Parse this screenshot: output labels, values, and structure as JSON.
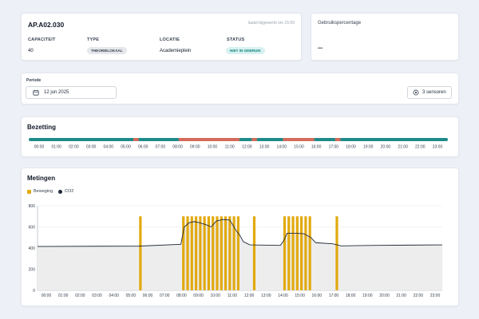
{
  "room": {
    "code": "AP.A02.030",
    "updated": "laatst bijgewerkt om 15:00",
    "fields": [
      {
        "label": "CAPACITEIT",
        "value": "40"
      },
      {
        "label": "TYPE",
        "value": "THEORIELOKAAL"
      },
      {
        "label": "LOCATIE",
        "value": "Academieplein"
      },
      {
        "label": "STATUS",
        "value": "NIET IN GEBRUIK"
      }
    ]
  },
  "usage": {
    "label": "Gebruikspercentage",
    "value": "–"
  },
  "period": {
    "label": "Periode",
    "date": "12 jun 2025",
    "sensors_button": "3 sensoren",
    "calendar_icon": "calendar-icon",
    "sensor_icon": "sensor-icon"
  },
  "occupancy": {
    "title": "Bezetting",
    "colors": {
      "free": "#1e8a8a",
      "occupied": "#d46a5a"
    },
    "ticks": [
      "00:00",
      "01:00",
      "02:00",
      "03:00",
      "04:00",
      "05:00",
      "06:00",
      "07:00",
      "08:00",
      "09:00",
      "10:00",
      "11:00",
      "12:00",
      "13:00",
      "14:00",
      "15:00",
      "16:00",
      "17:00",
      "18:00",
      "19:00",
      "20:00",
      "21:00",
      "22:00",
      "23:00"
    ],
    "segments": [
      {
        "from": 0.0,
        "to": 6.0,
        "state": "free"
      },
      {
        "from": 6.0,
        "to": 6.3,
        "state": "occupied"
      },
      {
        "from": 6.3,
        "to": 8.6,
        "state": "free"
      },
      {
        "from": 8.6,
        "to": 12.1,
        "state": "occupied"
      },
      {
        "from": 12.1,
        "to": 12.8,
        "state": "free"
      },
      {
        "from": 12.8,
        "to": 13.1,
        "state": "occupied"
      },
      {
        "from": 13.1,
        "to": 14.6,
        "state": "free"
      },
      {
        "from": 14.6,
        "to": 16.4,
        "state": "occupied"
      },
      {
        "from": 16.4,
        "to": 17.6,
        "state": "free"
      },
      {
        "from": 17.6,
        "to": 17.9,
        "state": "occupied"
      },
      {
        "from": 17.9,
        "to": 24.0,
        "state": "free"
      }
    ]
  },
  "metingen": {
    "title": "Metingen",
    "legend": [
      {
        "label": "Beweging",
        "color": "#e2a90f"
      },
      {
        "label": "CO2",
        "color": "#1f2937"
      }
    ]
  },
  "chart_data": {
    "type": "bar",
    "title": "Metingen",
    "series": [
      {
        "name": "Beweging",
        "kind": "bar",
        "color": "#e2a90f",
        "x": [
          6.1,
          8.65,
          8.9,
          9.15,
          9.4,
          9.65,
          9.9,
          10.15,
          10.4,
          10.65,
          10.9,
          11.15,
          11.4,
          11.65,
          11.9,
          12.85,
          14.65,
          14.9,
          15.15,
          15.4,
          15.65,
          15.9,
          16.15,
          17.75
        ],
        "values": [
          700,
          700,
          700,
          700,
          700,
          700,
          700,
          700,
          700,
          700,
          700,
          700,
          700,
          700,
          700,
          700,
          700,
          700,
          700,
          700,
          700,
          700,
          700,
          700
        ]
      },
      {
        "name": "CO2",
        "kind": "line",
        "color": "#1f2937",
        "x": [
          0,
          6.0,
          8.5,
          8.7,
          9.0,
          9.3,
          9.6,
          10.0,
          10.3,
          10.6,
          11.0,
          11.4,
          11.8,
          12.0,
          12.2,
          12.6,
          14.4,
          14.6,
          14.8,
          15.3,
          15.8,
          16.2,
          16.5,
          17.5,
          18.0,
          20.0,
          24.0
        ],
        "values": [
          415,
          418,
          435,
          600,
          640,
          650,
          640,
          620,
          600,
          655,
          670,
          665,
          560,
          520,
          460,
          430,
          425,
          470,
          540,
          540,
          535,
          500,
          450,
          440,
          420,
          425,
          430
        ]
      }
    ],
    "x_ticks": [
      "00:00",
      "01:00",
      "02:00",
      "03:00",
      "04:00",
      "05:00",
      "06:00",
      "07:00",
      "08:00",
      "09:00",
      "10:00",
      "11:00",
      "12:00",
      "13:00",
      "14:00",
      "15:00",
      "16:00",
      "17:00",
      "18:00",
      "19:00",
      "20:00",
      "21:00",
      "22:00",
      "23:00"
    ],
    "ylim": [
      0,
      800
    ],
    "y_ticks": [
      "0",
      "200",
      "400",
      "600",
      "800"
    ],
    "grid": true,
    "legend_position": "top-left"
  }
}
